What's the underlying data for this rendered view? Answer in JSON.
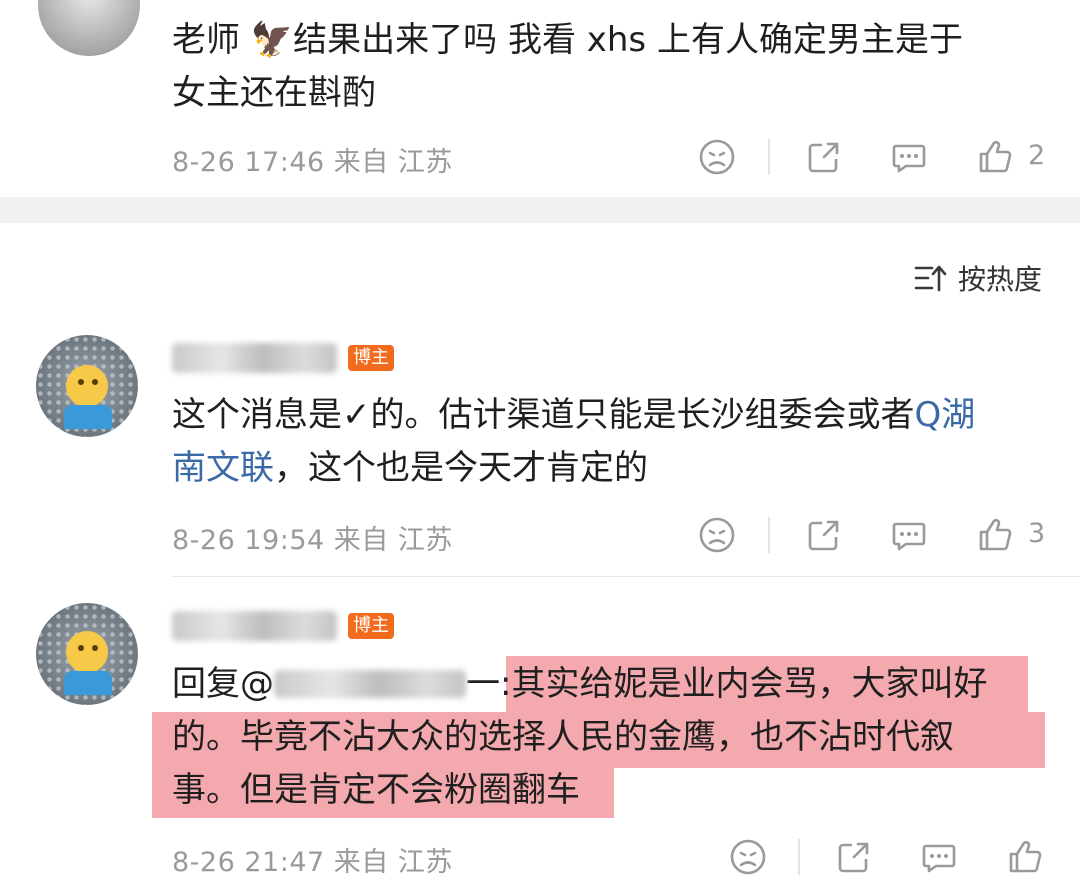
{
  "comments": [
    {
      "text_line1": "老师 🦅结果出来了吗 我看 xhs 上有人确定男主是于",
      "text_line2": "女主还在斟酌",
      "meta": "8-26 17:46 来自 江苏",
      "likes": "2"
    },
    {
      "badge": "博主",
      "text_line1_a": "这个消息是✓的。估计渠道只能是长沙组委会或者",
      "link_a": "Q湖",
      "link_b": "南文联",
      "text_line2_b": "，这个也是今天才肯定的",
      "meta": "8-26 19:54 来自 江苏",
      "likes": "3"
    },
    {
      "badge": "博主",
      "reply_prefix": "回复@",
      "reply_suffix": "一",
      "hl_line1": ":其实给妮是业内会骂，大家叫好",
      "hl_line2": "的。毕竟不沾大众的选择人民的金鹰，也不沾时代叙",
      "hl_line3": "事。但是肯定不会粉圈翻车",
      "meta": "8-26 21:47 来自 江苏"
    }
  ],
  "sort": {
    "label": "按热度",
    "icon": "sort-icon"
  },
  "colors": {
    "badge": "#f26a1b",
    "link": "#3a6aa6",
    "highlight": "#f3a9ae",
    "meta": "#9a9a9a"
  }
}
